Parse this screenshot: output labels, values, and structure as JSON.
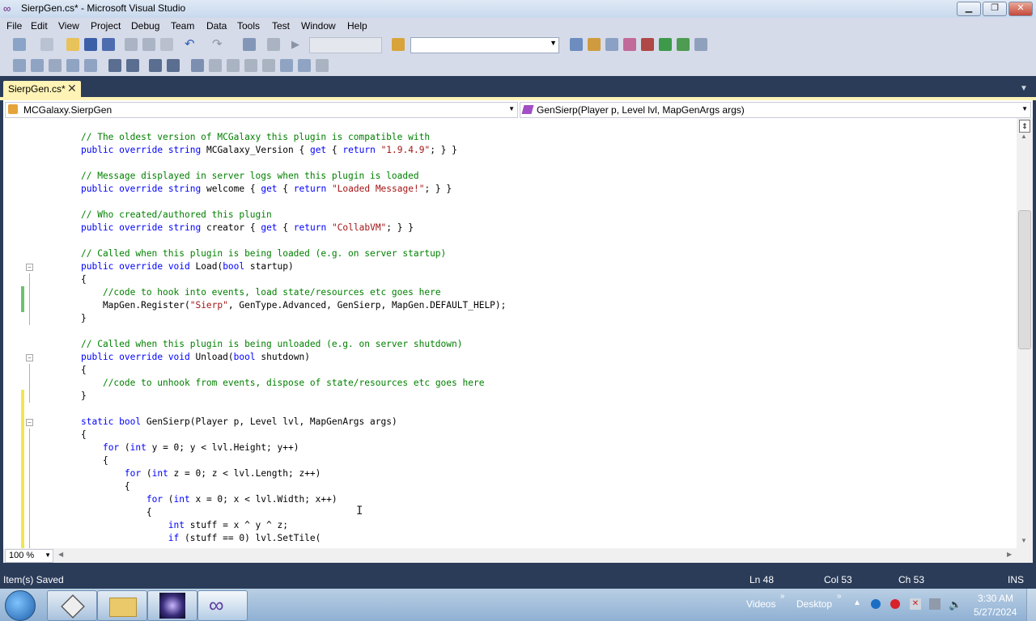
{
  "window": {
    "title": "SierpGen.cs* - Microsoft Visual Studio",
    "app_icon": "visual-studio-logo",
    "controls": [
      "minimize",
      "restore",
      "close"
    ]
  },
  "menu": [
    "File",
    "Edit",
    "View",
    "Project",
    "Debug",
    "Team",
    "Data",
    "Tools",
    "Test",
    "Window",
    "Help"
  ],
  "tab": {
    "label": "SierpGen.cs*",
    "close": "✕"
  },
  "navigation": {
    "type_combo": "MCGalaxy.SierpGen",
    "member_combo": "GenSierp(Player p, Level lvl, MapGenArgs args)"
  },
  "editor": {
    "lines": [
      {
        "text": "// The oldest version of MCGalaxy this plugin is compatible with"
      },
      {
        "text": "public override string MCGalaxy_Version { get { return \"1.9.4.9\"; } }"
      },
      {
        "text": ""
      },
      {
        "text": "// Message displayed in server logs when this plugin is loaded"
      },
      {
        "text": "public override string welcome { get { return \"Loaded Message!\"; } }"
      },
      {
        "text": ""
      },
      {
        "text": "// Who created/authored this plugin"
      },
      {
        "text": "public override string creator { get { return \"CollabVM\"; } }"
      },
      {
        "text": ""
      },
      {
        "text": "// Called when this plugin is being loaded (e.g. on server startup)"
      },
      {
        "text": "public override void Load(bool startup)"
      },
      {
        "text": "{"
      },
      {
        "text": "    //code to hook into events, load state/resources etc goes here"
      },
      {
        "text": "    MapGen.Register(\"Sierp\", GenType.Advanced, GenSierp, MapGen.DEFAULT_HELP);"
      },
      {
        "text": "}"
      },
      {
        "text": ""
      },
      {
        "text": "// Called when this plugin is being unloaded (e.g. on server shutdown)"
      },
      {
        "text": "public override void Unload(bool shutdown)"
      },
      {
        "text": "{"
      },
      {
        "text": "    //code to unhook from events, dispose of state/resources etc goes here"
      },
      {
        "text": "}"
      },
      {
        "text": ""
      },
      {
        "text": "static bool GenSierp(Player p, Level lvl, MapGenArgs args)"
      },
      {
        "text": "{"
      },
      {
        "text": "    for (int y = 0; y < lvl.Height; y++)"
      },
      {
        "text": "    {"
      },
      {
        "text": "        for (int z = 0; z < lvl.Length; z++)"
      },
      {
        "text": "        {"
      },
      {
        "text": "            for (int x = 0; x < lvl.Width; x++)"
      },
      {
        "text": "            {"
      },
      {
        "text": "                int stuff = x ^ y ^ z;"
      },
      {
        "text": "                if (stuff == 0) lvl.SetTile("
      }
    ],
    "zoom": "100 %"
  },
  "status": {
    "message": "Item(s) Saved",
    "line": "Ln 48",
    "col": "Col 53",
    "ch": "Ch 53",
    "mode": "INS"
  },
  "taskbar": {
    "toolbars": [
      "Videos",
      "Desktop"
    ],
    "clock_time": "3:30 AM",
    "clock_date": "5/27/2024"
  },
  "colors": {
    "keyword": "#0000ff",
    "comment": "#008000",
    "string": "#a31515",
    "tab_active": "#fff3b5",
    "chrome": "#2b3c59"
  }
}
